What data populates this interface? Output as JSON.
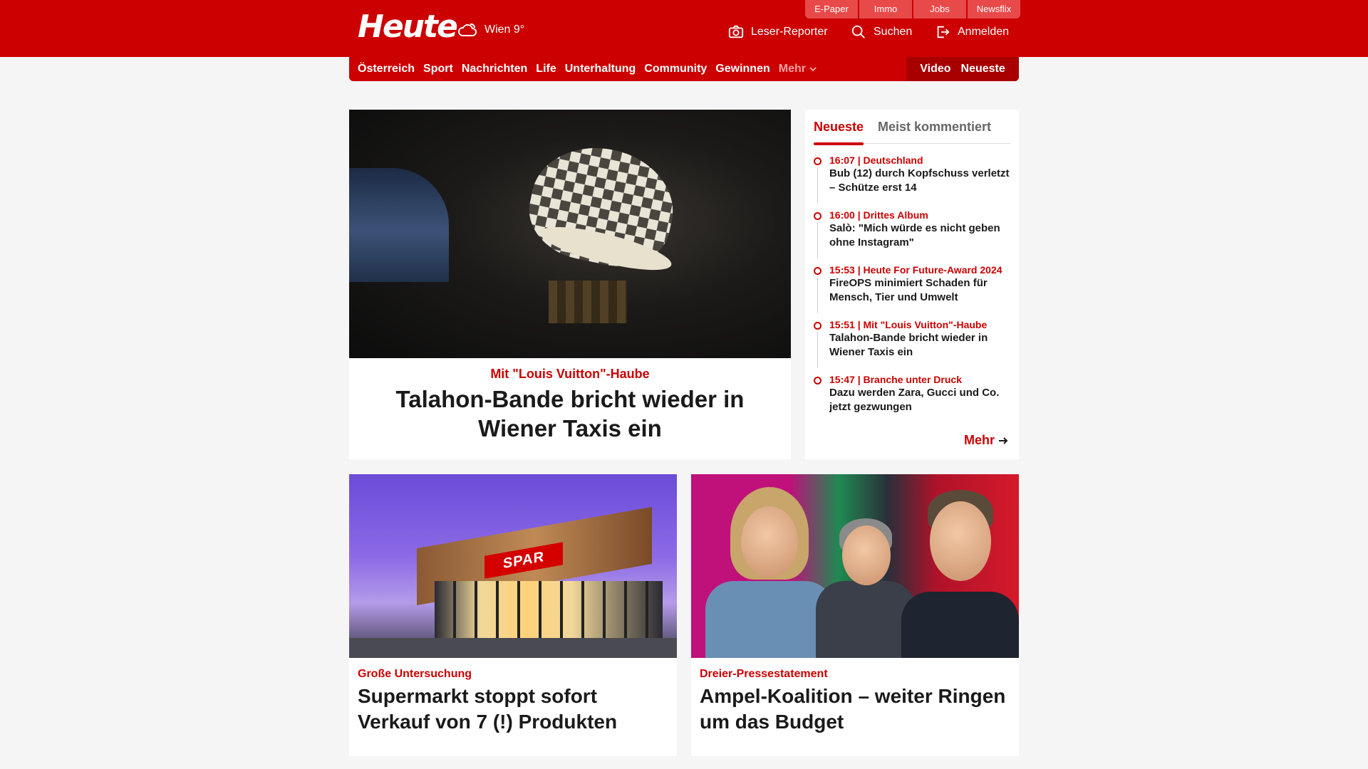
{
  "brand": {
    "logo": "Heute",
    "weather": "Wien 9°",
    "accent": "#cc0000"
  },
  "toplinks": [
    "E-Paper",
    "Immo",
    "Jobs",
    "Newsflix"
  ],
  "header_actions": {
    "reporter": "Leser-Reporter",
    "search": "Suchen",
    "login": "Anmelden"
  },
  "nav": {
    "items": [
      "Österreich",
      "Sport",
      "Nachrichten",
      "Life",
      "Unterhaltung",
      "Community",
      "Gewinnen"
    ],
    "more": "Mehr",
    "right": [
      "Video",
      "Neueste"
    ]
  },
  "lead": {
    "kicker": "Mit \"Louis Vuitton\"-Haube",
    "title": "Talahon-Bande bricht wieder in Wiener Taxis ein"
  },
  "sidebar": {
    "tabs": [
      "Neueste",
      "Meist kommentiert"
    ],
    "items": [
      {
        "meta": "16:07 | Deutschland",
        "title": "Bub (12) durch Kopfschuss verletzt – Schütze erst 14"
      },
      {
        "meta": "16:00 | Drittes Album",
        "title": "Salò: \"Mich würde es nicht geben ohne Instagram\""
      },
      {
        "meta": "15:53 | Heute For Future-Award 2024",
        "title": "FireOPS minimiert Schaden für Mensch, Tier und Umwelt"
      },
      {
        "meta": "15:51 | Mit \"Louis Vuitton\"-Haube",
        "title": "Talahon-Bande bricht wieder in Wiener Taxis ein"
      },
      {
        "meta": "15:47 | Branche unter Druck",
        "title": "Dazu werden Zara, Gucci und Co. jetzt gezwungen"
      }
    ],
    "more": "Mehr"
  },
  "cards": [
    {
      "kicker": "Große Untersuchung",
      "title": "Supermarkt stoppt sofort Verkauf von 7 (!) Produkten",
      "sign": "SPAR"
    },
    {
      "kicker": "Dreier-Pressestatement",
      "title": "Ampel-Koalition – weiter Ringen um das Budget"
    }
  ]
}
